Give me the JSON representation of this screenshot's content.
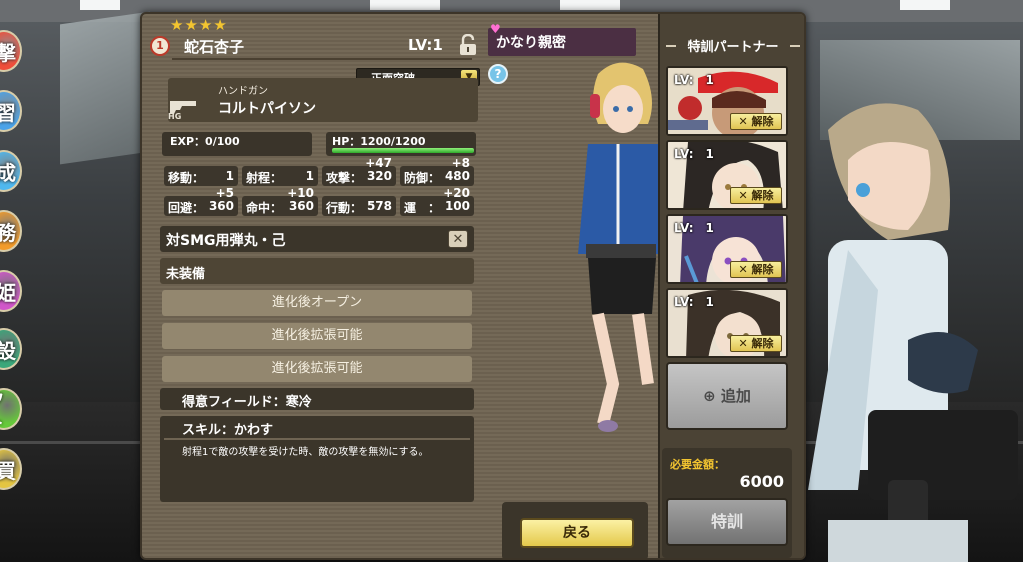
{
  "side_menu": [
    {
      "label": "撃",
      "color": "#ef4e3a"
    },
    {
      "label": "習",
      "color": "#4ba3e8"
    },
    {
      "label": "成",
      "color": "#4fb8ef"
    },
    {
      "label": "務",
      "color": "#f29b2a"
    },
    {
      "label": "姫",
      "color": "#d156c9"
    },
    {
      "label": "設",
      "color": "#3aa77a"
    },
    {
      "label": "ウト",
      "color": "#66c93a"
    },
    {
      "label": "買",
      "color": "#e4c542"
    }
  ],
  "character": {
    "stars": "★★★★",
    "rarity": "1",
    "name": "蛇石杏子",
    "level": "LV:1",
    "affinity": "かなり親密",
    "tactic": "正面突破",
    "weapon_type": "ハンドガン",
    "weapon_name": "コルトパイソン",
    "weapon_class": "HG",
    "exp": "EXP：0/100",
    "hp": "HP：1200/1200",
    "hp_ratio": 1.0
  },
  "stats": {
    "move": {
      "label": "移動：",
      "value": "1"
    },
    "range": {
      "label": "射程：",
      "value": "1"
    },
    "attack": {
      "label": "攻撃：",
      "value": "320",
      "bonus": "+47"
    },
    "defense": {
      "label": "防御：",
      "value": "480",
      "bonus": "+8"
    },
    "evade": {
      "label": "回避：",
      "value": "360",
      "bonus": "+5"
    },
    "accuracy": {
      "label": "命中：",
      "value": "360",
      "bonus": "+10"
    },
    "action": {
      "label": "行動：",
      "value": "578"
    },
    "luck": {
      "label": "運　：",
      "value": "100",
      "bonus": "+20"
    }
  },
  "equipment": {
    "equipped": "対SMG用弾丸・己",
    "unequipped_title": "未装備",
    "slots": [
      "進化後オープン",
      "進化後拡張可能",
      "進化後拡張可能"
    ]
  },
  "field": "得意フィールド：寒冷",
  "skill": {
    "title": "スキル：かわす",
    "description": "射程1で敵の攻撃を受けた時、敵の攻撃を無効にする。"
  },
  "buttons": {
    "back": "戻る",
    "add": "追加",
    "train": "特訓"
  },
  "partners": {
    "title": "特訓パートナー",
    "cards": [
      {
        "lv": "LV:　1",
        "release": "解除"
      },
      {
        "lv": "LV:　1",
        "release": "解除"
      },
      {
        "lv": "LV:　1",
        "release": "解除"
      },
      {
        "lv": "LV:　1",
        "release": "解除"
      }
    ]
  },
  "cost": {
    "label": "必要金額：",
    "value": "6000"
  }
}
